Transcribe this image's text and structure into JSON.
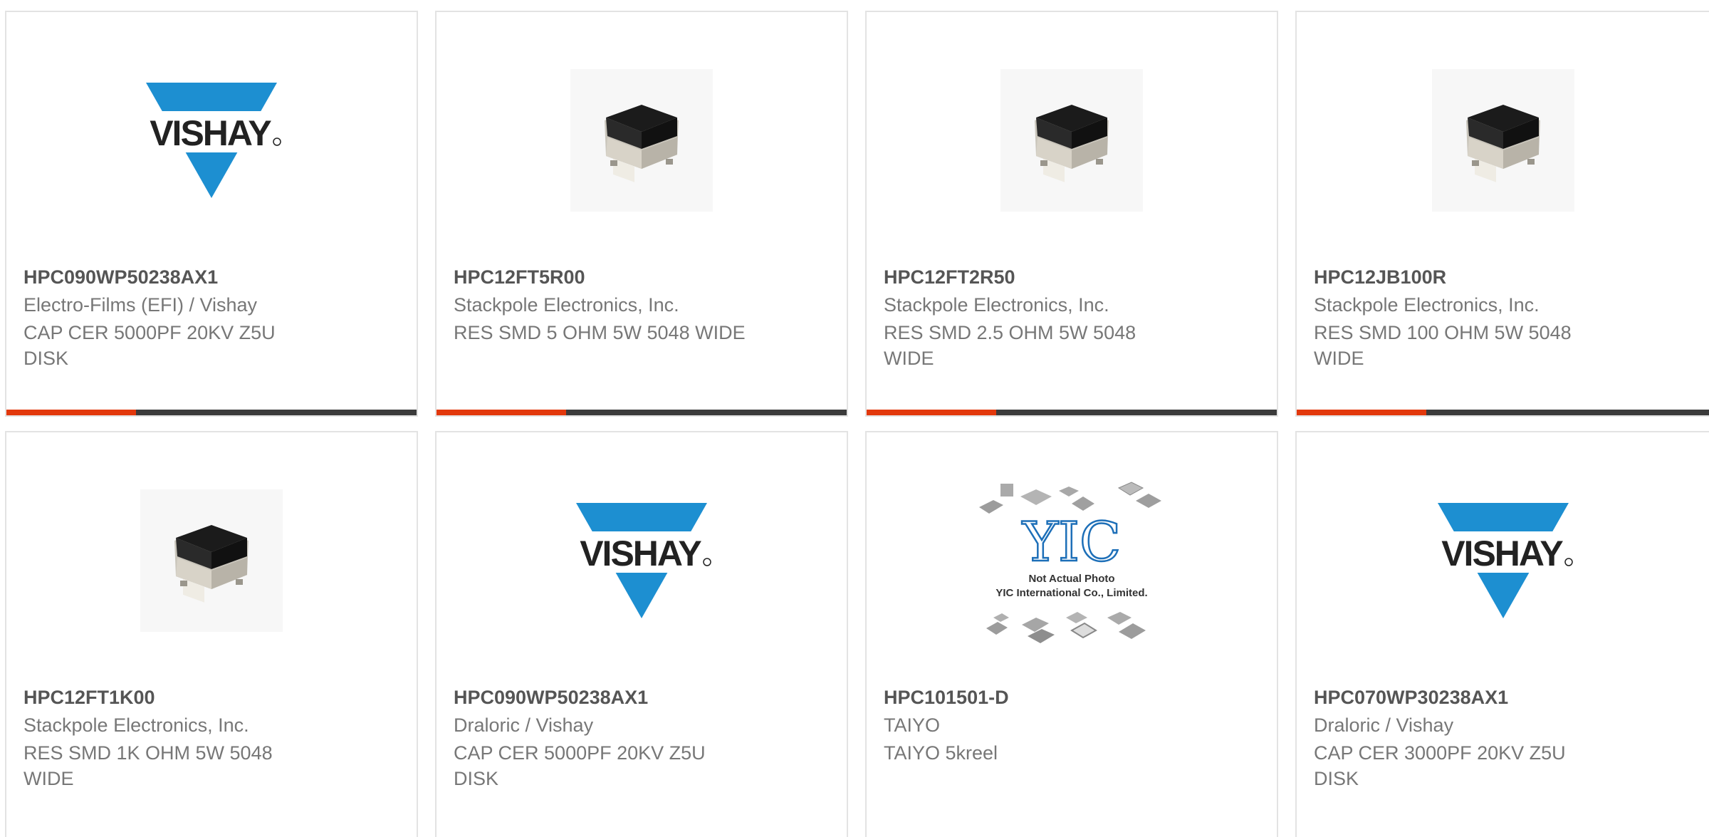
{
  "colors": {
    "accent": "#e2380c",
    "bar_dark": "#3b3b3b",
    "vishay_blue": "#1d8fd1",
    "text_title": "#555555",
    "text_body": "#777777"
  },
  "products": [
    {
      "part_number": "HPC090WP50238AX1",
      "manufacturer": "Electro-Films (EFI) / Vishay",
      "description": "CAP CER 5000PF 20KV Z5U DISK",
      "image": "vishay-logo",
      "brand_text": "VISHAY"
    },
    {
      "part_number": "HPC12FT5R00",
      "manufacturer": "Stackpole Electronics, Inc.",
      "description": "RES SMD 5 OHM 5W 5048 WIDE",
      "image": "resistor-photo"
    },
    {
      "part_number": "HPC12FT2R50",
      "manufacturer": "Stackpole Electronics, Inc.",
      "description": "RES SMD 2.5 OHM 5W 5048 WIDE",
      "image": "resistor-photo"
    },
    {
      "part_number": "HPC12JB100R",
      "manufacturer": "Stackpole Electronics, Inc.",
      "description": "RES SMD 100 OHM 5W 5048 WIDE",
      "image": "resistor-photo"
    },
    {
      "part_number": "HPC12FT1K00",
      "manufacturer": "Stackpole Electronics, Inc.",
      "description": "RES SMD 1K OHM 5W 5048 WIDE",
      "image": "resistor-photo"
    },
    {
      "part_number": "HPC090WP50238AX1",
      "manufacturer": "Draloric / Vishay",
      "description": "CAP CER 5000PF 20KV Z5U DISK",
      "image": "vishay-logo",
      "brand_text": "VISHAY"
    },
    {
      "part_number": "HPC101501-D",
      "manufacturer": "TAIYO",
      "description": "TAIYO 5kreel",
      "image": "yic-placeholder",
      "image_text_line1": "Not Actual Photo",
      "image_text_line2": "YIC International Co., Limited.",
      "brand_text": "YIC"
    },
    {
      "part_number": "HPC070WP30238AX1",
      "manufacturer": "Draloric / Vishay",
      "description": "CAP CER 3000PF 20KV Z5U DISK",
      "image": "vishay-logo",
      "brand_text": "VISHAY"
    }
  ]
}
